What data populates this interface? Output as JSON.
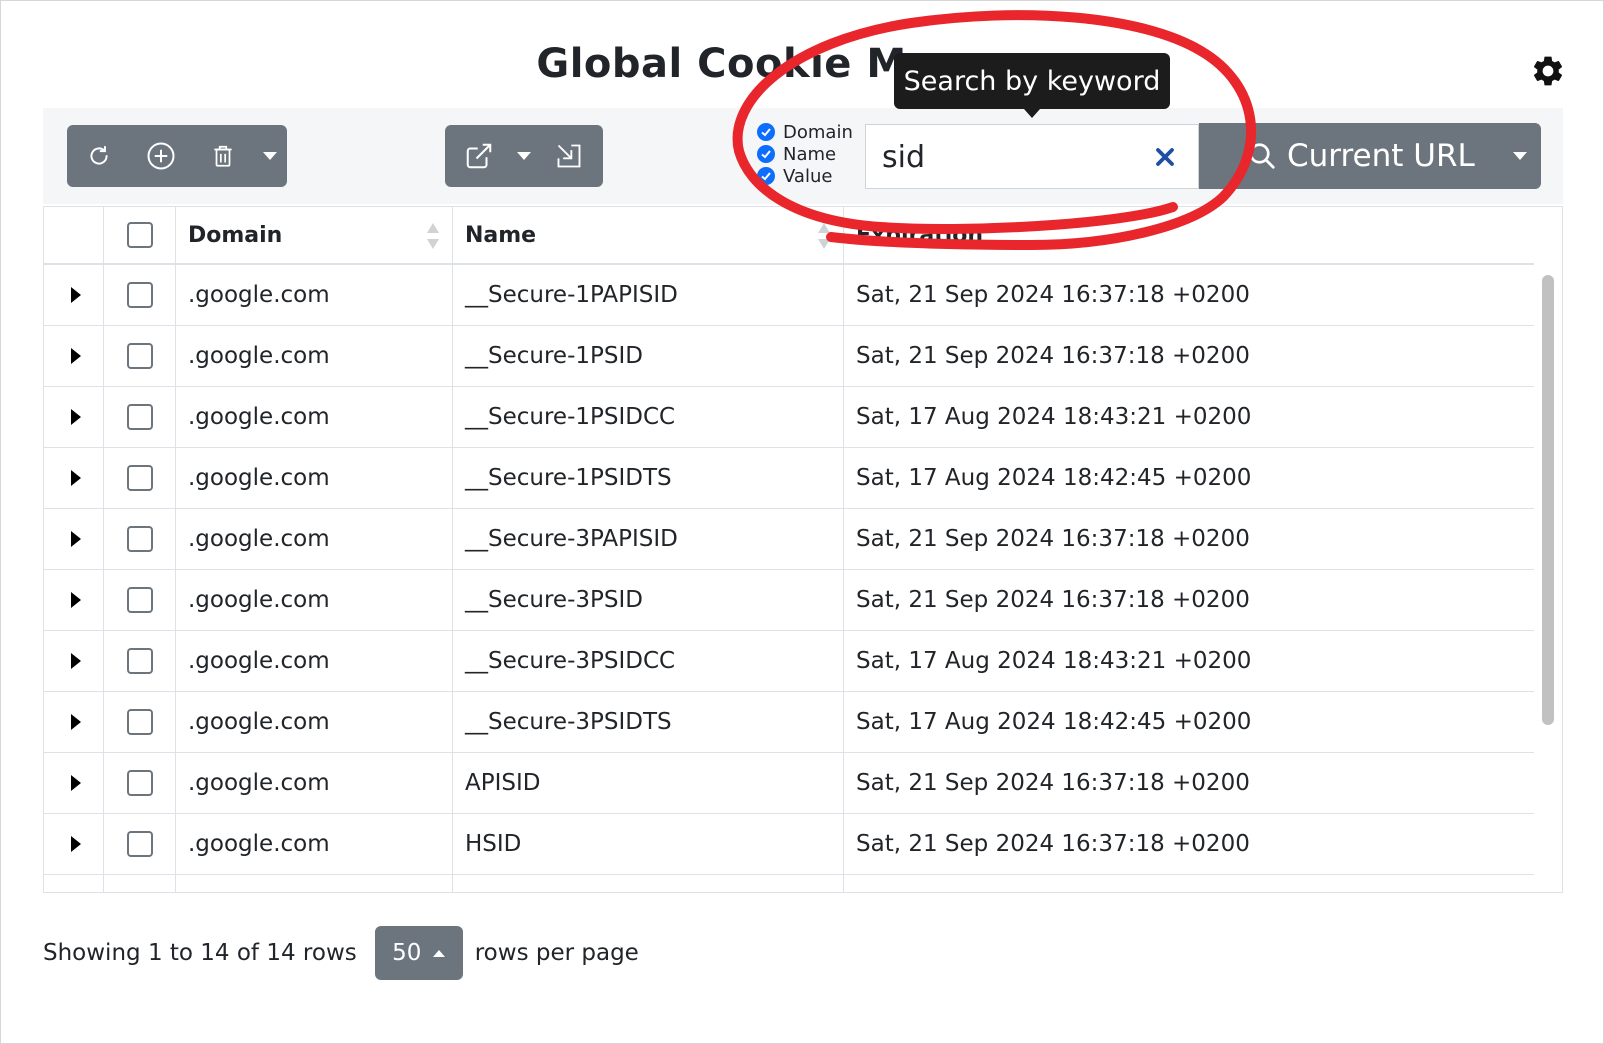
{
  "app": {
    "title": "Global Cookie Manager"
  },
  "icons": {
    "settings": "gear-icon",
    "refresh": "refresh-icon",
    "add": "plus-circle-icon",
    "delete": "trash-icon",
    "export": "external-link-icon",
    "import": "import-icon",
    "search": "search-icon",
    "clear": "close-icon"
  },
  "search": {
    "filters": [
      {
        "label": "Domain",
        "checked": true
      },
      {
        "label": "Name",
        "checked": true
      },
      {
        "label": "Value",
        "checked": true
      }
    ],
    "value": "sid",
    "tooltip": "Search by keyword",
    "scope_label": "Current URL"
  },
  "table": {
    "columns": [
      "Domain",
      "Name",
      "Expiration"
    ],
    "rows": [
      {
        "domain": ".google.com",
        "name": "__Secure-1PAPISID",
        "expiration": "Sat, 21 Sep 2024 16:37:18 +0200"
      },
      {
        "domain": ".google.com",
        "name": "__Secure-1PSID",
        "expiration": "Sat, 21 Sep 2024 16:37:18 +0200"
      },
      {
        "domain": ".google.com",
        "name": "__Secure-1PSIDCC",
        "expiration": "Sat, 17 Aug 2024 18:43:21 +0200"
      },
      {
        "domain": ".google.com",
        "name": "__Secure-1PSIDTS",
        "expiration": "Sat, 17 Aug 2024 18:42:45 +0200"
      },
      {
        "domain": ".google.com",
        "name": "__Secure-3PAPISID",
        "expiration": "Sat, 21 Sep 2024 16:37:18 +0200"
      },
      {
        "domain": ".google.com",
        "name": "__Secure-3PSID",
        "expiration": "Sat, 21 Sep 2024 16:37:18 +0200"
      },
      {
        "domain": ".google.com",
        "name": "__Secure-3PSIDCC",
        "expiration": "Sat, 17 Aug 2024 18:43:21 +0200"
      },
      {
        "domain": ".google.com",
        "name": "__Secure-3PSIDTS",
        "expiration": "Sat, 17 Aug 2024 18:42:45 +0200"
      },
      {
        "domain": ".google.com",
        "name": "APISID",
        "expiration": "Sat, 21 Sep 2024 16:37:18 +0200"
      },
      {
        "domain": ".google.com",
        "name": "HSID",
        "expiration": "Sat, 21 Sep 2024 16:37:18 +0200"
      }
    ]
  },
  "footer": {
    "showing": "Showing 1 to 14 of 14 rows",
    "page_size": "50",
    "per_page": "rows per page"
  },
  "colors": {
    "button": "#6c757d",
    "accent": "#0d6efd",
    "annotation": "#e8262b",
    "tooltip": "#1c1c1c"
  }
}
